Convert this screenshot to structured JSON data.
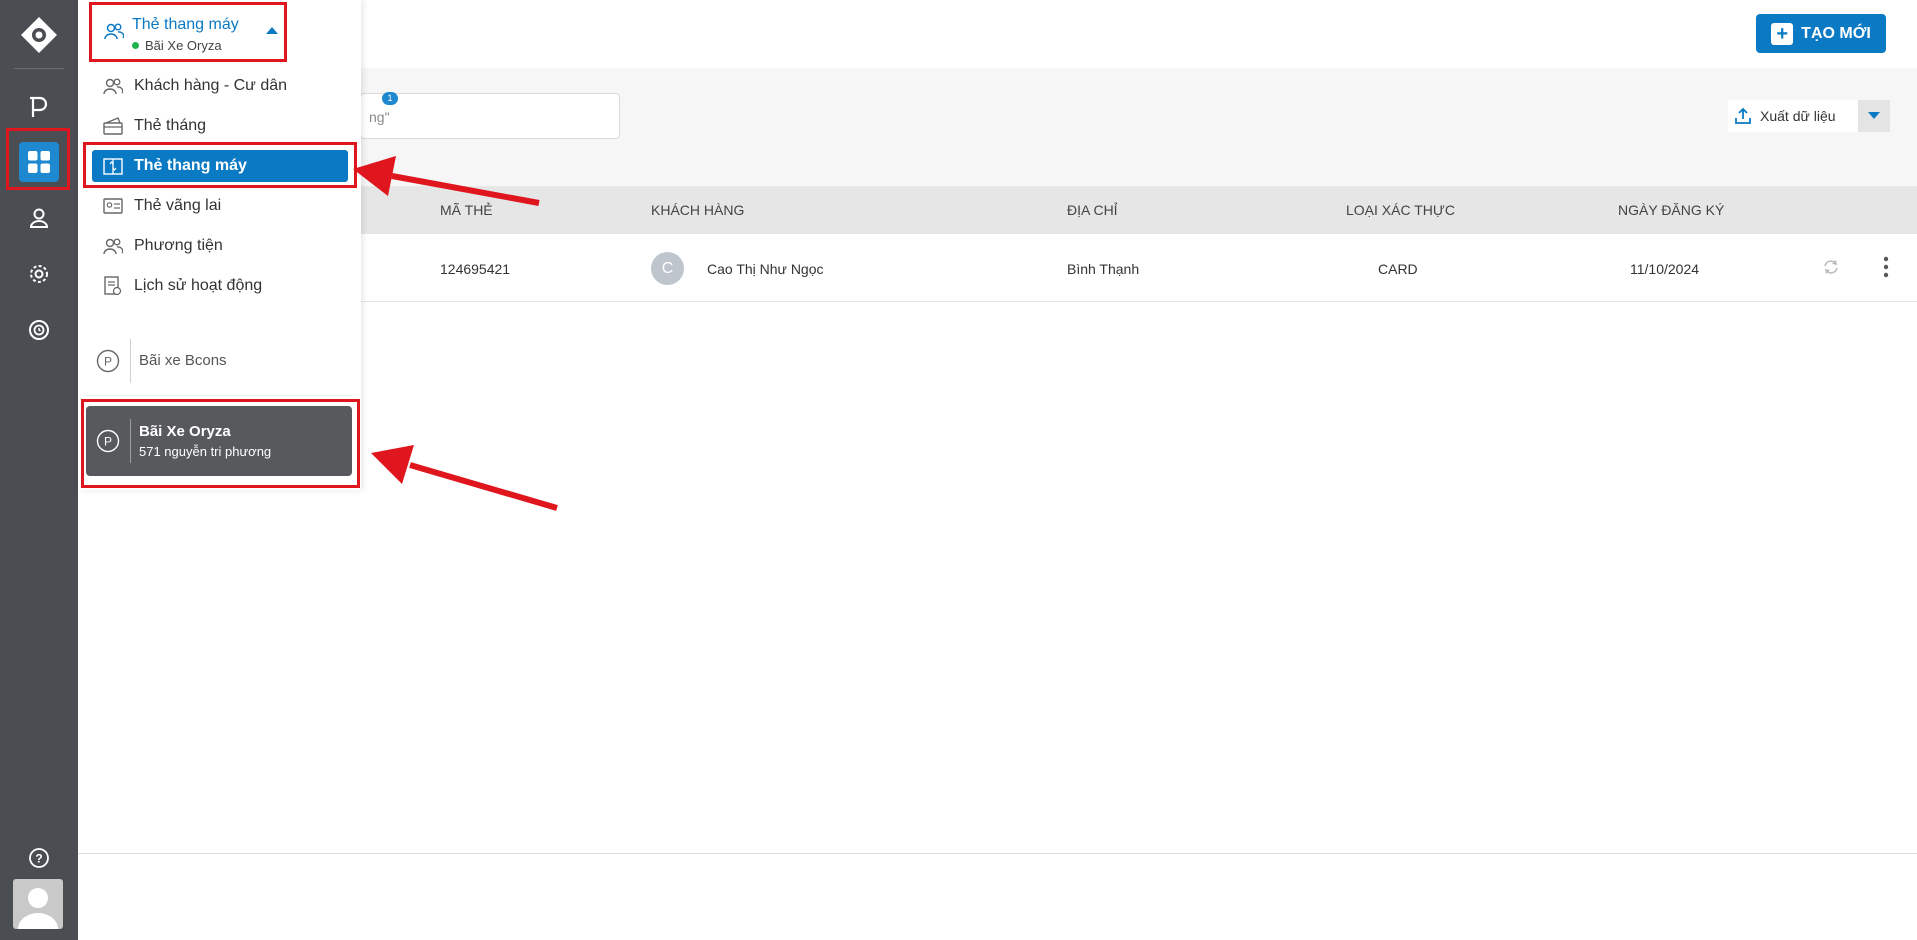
{
  "rail": {
    "icons": [
      "logo-icon",
      "parking-icon",
      "grid-icon",
      "user-icon",
      "gear-icon",
      "history-icon",
      "help-icon"
    ]
  },
  "header": {
    "create_label": "TẠO MỚI"
  },
  "toolbar": {
    "search_text": "ng\"",
    "export_label": "Xuất dữ liệu",
    "count_badge": "1"
  },
  "table": {
    "headers": [
      "MÃ THẺ",
      "KHÁCH HÀNG",
      "ĐỊA CHỈ",
      "LOẠI XÁC THỰC",
      "NGÀY ĐĂNG KÝ"
    ],
    "rows": [
      {
        "card_id": "124695421",
        "avatar_letter": "C",
        "customer": "Cao Thị Như Ngọc",
        "address": "Bình Thạnh",
        "auth_type": "CARD",
        "registered": "11/10/2024"
      }
    ]
  },
  "panel": {
    "title": "Thẻ thang máy",
    "subtitle": "Bãi Xe Oryza",
    "menu": [
      {
        "label": "Khách hàng - Cư dân",
        "icon": "users-icon"
      },
      {
        "label": "Thẻ tháng",
        "icon": "card-icon"
      },
      {
        "label": "Thẻ thang máy",
        "icon": "elevator-icon",
        "active": true
      },
      {
        "label": "Thẻ vãng lai",
        "icon": "id-card-icon"
      },
      {
        "label": "Phương tiện",
        "icon": "vehicle-icon"
      },
      {
        "label": "Lịch sử hoạt động",
        "icon": "log-icon"
      }
    ],
    "lots": [
      {
        "name": "Bãi xe Bcons",
        "address": ""
      },
      {
        "name": "Bãi Xe Oryza",
        "address": "571 nguyễn tri phương"
      }
    ]
  },
  "colors": {
    "accent": "#0b7ac4",
    "rail": "#4a4d52",
    "annotation": "#e0161e",
    "status_dot": "#1fb34d"
  }
}
